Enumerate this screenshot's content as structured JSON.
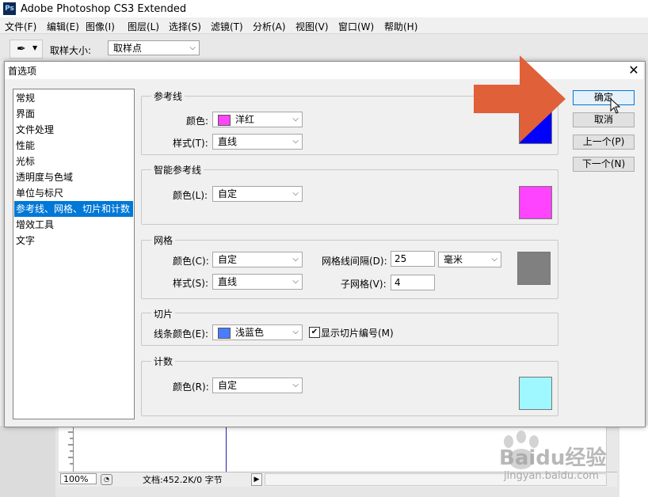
{
  "app": {
    "title": "Adobe Photoshop CS3 Extended",
    "logo_text": "Ps"
  },
  "menu": [
    "文件(F)",
    "编辑(E)",
    "图像(I)",
    "图层(L)",
    "选择(S)",
    "滤镜(T)",
    "分析(A)",
    "视图(V)",
    "窗口(W)",
    "帮助(H)"
  ],
  "options_bar": {
    "sample_size_label": "取样大小:",
    "sample_size_value": "取样点"
  },
  "document": {
    "zoom": "100%",
    "doc_info": "文档:452.2K/0 字节"
  },
  "dialog": {
    "title": "首选项",
    "categories": [
      "常规",
      "界面",
      "文件处理",
      "性能",
      "光标",
      "透明度与色域",
      "单位与标尺",
      "参考线、网格、切片和计数",
      "增效工具",
      "文字"
    ],
    "selected_category": "参考线、网格、切片和计数",
    "buttons": {
      "ok": "确定",
      "cancel": "取消",
      "prev": "上一个(P)",
      "next": "下一个(N)"
    },
    "guides": {
      "title": "参考线",
      "color_label": "颜色:",
      "color_value": "洋红",
      "color_swatch": "#ff44ff",
      "style_label": "样式(T):",
      "style_value": "直线",
      "preview_color": "#0000ff"
    },
    "smart_guides": {
      "title": "智能参考线",
      "color_label": "颜色(L):",
      "color_value": "自定",
      "preview_color": "#ff44ff"
    },
    "grid": {
      "title": "网格",
      "color_label": "颜色(C):",
      "color_value": "自定",
      "style_label": "样式(S):",
      "style_value": "直线",
      "gridline_label": "网格线间隔(D):",
      "gridline_value": "25",
      "unit_value": "毫米",
      "subdiv_label": "子网格(V):",
      "subdiv_value": "4",
      "preview_color": "#808080"
    },
    "slices": {
      "title": "切片",
      "color_label": "线条颜色(E):",
      "color_value": "浅蓝色",
      "color_swatch": "#4a7cff",
      "show_numbers_label": "显示切片编号(M)",
      "show_numbers_checked": true
    },
    "count": {
      "title": "计数",
      "color_label": "颜色(R):",
      "color_value": "自定",
      "preview_color": "#9ff7ff"
    }
  },
  "watermark": {
    "brand": "Baidu经验",
    "url": "jingyan.baidu.com"
  },
  "colors": {
    "annotation_arrow": "#e0603a",
    "selection": "#0078d7"
  }
}
